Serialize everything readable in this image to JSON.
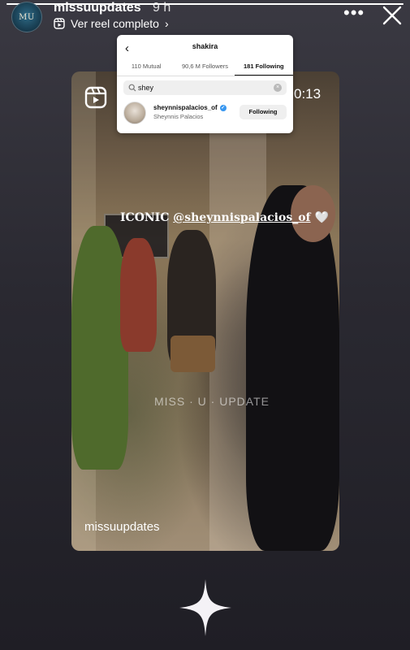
{
  "story": {
    "username": "missuupdates",
    "time_ago": "9 h",
    "reel_link_label": "Ver reel completo",
    "avatar_text": "MU",
    "progress": 1.0
  },
  "reel": {
    "timer": "0:13",
    "caption_prefix": "ICONIC ",
    "caption_mention": "@sheynnispalacios_of",
    "caption_emoji": "🤍",
    "watermark": "MISS · U · UPDATE",
    "handle": "missuupdates"
  },
  "instagram_overlay": {
    "profile_title": "shakira",
    "tabs": [
      {
        "label": "110 Mutual",
        "active": false
      },
      {
        "label": "90,6 M Followers",
        "active": false
      },
      {
        "label": "181 Following",
        "active": true
      }
    ],
    "search_query": "shey",
    "result": {
      "handle": "sheynnispalacios_of",
      "full_name": "Sheynnis Palacios",
      "verified": true,
      "button_label": "Following"
    }
  },
  "colors": {
    "background": "#2a2931",
    "verified_blue": "#3897f0"
  },
  "icons": [
    "reel-icon",
    "chevron-right-icon",
    "more-icon",
    "close-icon",
    "back-icon",
    "search-icon",
    "clear-icon",
    "verified-icon",
    "sparkle-icon"
  ]
}
